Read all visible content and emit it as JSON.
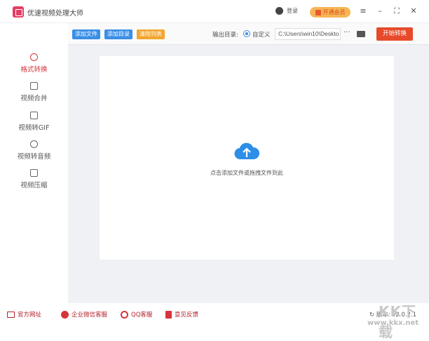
{
  "app": {
    "title": "优速视频处理大师"
  },
  "header": {
    "login": "登录",
    "vip": "开通会员"
  },
  "sidebar": {
    "items": [
      {
        "label": "格式转换"
      },
      {
        "label": "视频合并"
      },
      {
        "label": "视频转GIF"
      },
      {
        "label": "视频转音频"
      },
      {
        "label": "视频压缩"
      }
    ]
  },
  "toolbar": {
    "add_file": "添加文件",
    "add_dir": "添加目录",
    "clear_list": "清除列表",
    "output_label": "输出目录:",
    "custom": "自定义",
    "path": "C:\\Users\\win10\\Deskto",
    "more": "···",
    "start": "开始转换"
  },
  "dropzone": {
    "hint": "点击添加文件或拖拽文件到此"
  },
  "footer": {
    "links": [
      {
        "label": "官方网址"
      },
      {
        "label": "企业微信客服"
      },
      {
        "label": "QQ客服"
      },
      {
        "label": "意见反馈"
      }
    ],
    "version": "版本: v2.0.2.1"
  },
  "watermark": {
    "logo": "KK下载",
    "url": "www.kkx.net"
  }
}
